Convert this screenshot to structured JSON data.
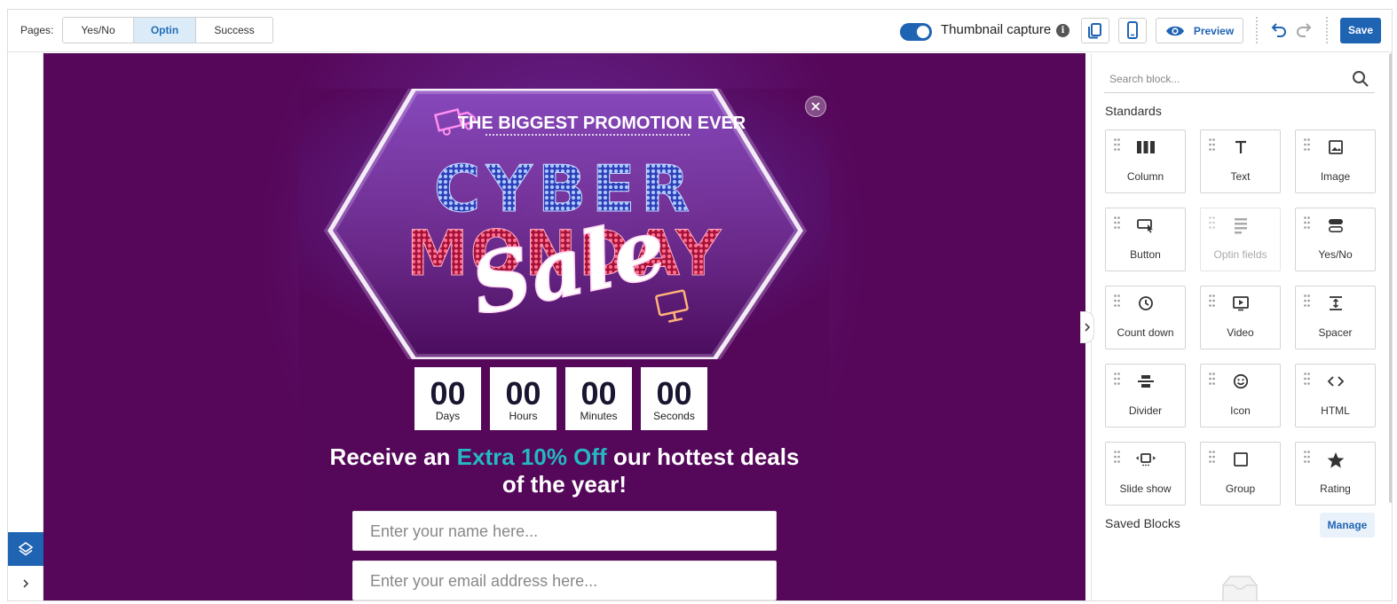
{
  "toolbar": {
    "pages_label": "Pages:",
    "page_tabs": [
      {
        "label": "Yes/No",
        "active": false
      },
      {
        "label": "Optin",
        "active": true
      },
      {
        "label": "Success",
        "active": false
      }
    ],
    "thumbnail_capture_label": "Thumbnail capture",
    "thumbnail_capture_on": true,
    "info_glyph": "i",
    "preview_label": "Preview",
    "save_label": "Save",
    "accent_color": "#1f63b3"
  },
  "canvas": {
    "background_color": "#56075a",
    "hero": {
      "kicker": "THE BIGGEST PROMOTION EVER",
      "word1": "CYBER",
      "word2": "MONDAY",
      "script": "Sale"
    },
    "countdown": [
      {
        "value": "00",
        "unit": "Days"
      },
      {
        "value": "00",
        "unit": "Hours"
      },
      {
        "value": "00",
        "unit": "Minutes"
      },
      {
        "value": "00",
        "unit": "Seconds"
      }
    ],
    "headline": {
      "before": "Receive an",
      "accent": "Extra 10% Off",
      "after": "our hottest deals of the year!",
      "accent_color": "#25b8c2"
    },
    "name_placeholder": "Enter your name here...",
    "email_placeholder": "Enter your email address here..."
  },
  "panel": {
    "search_placeholder": "Search block...",
    "standards_title": "Standards",
    "blocks": [
      {
        "label": "Column",
        "icon": "column-icon",
        "enabled": true
      },
      {
        "label": "Text",
        "icon": "text-icon",
        "enabled": true
      },
      {
        "label": "Image",
        "icon": "image-icon",
        "enabled": true
      },
      {
        "label": "Button",
        "icon": "button-icon",
        "enabled": true
      },
      {
        "label": "Optin fields",
        "icon": "optin-fields-icon",
        "enabled": false
      },
      {
        "label": "Yes/No",
        "icon": "yes-no-icon",
        "enabled": true
      },
      {
        "label": "Count down",
        "icon": "clock-icon",
        "enabled": true
      },
      {
        "label": "Video",
        "icon": "video-icon",
        "enabled": true
      },
      {
        "label": "Spacer",
        "icon": "spacer-icon",
        "enabled": true
      },
      {
        "label": "Divider",
        "icon": "divider-icon",
        "enabled": true
      },
      {
        "label": "Icon",
        "icon": "smiley-icon",
        "enabled": true
      },
      {
        "label": "HTML",
        "icon": "code-icon",
        "enabled": true
      },
      {
        "label": "Slide show",
        "icon": "slideshow-icon",
        "enabled": true
      },
      {
        "label": "Group",
        "icon": "group-icon",
        "enabled": true
      },
      {
        "label": "Rating",
        "icon": "star-icon",
        "enabled": true
      }
    ],
    "saved_blocks_title": "Saved Blocks",
    "manage_label": "Manage"
  }
}
